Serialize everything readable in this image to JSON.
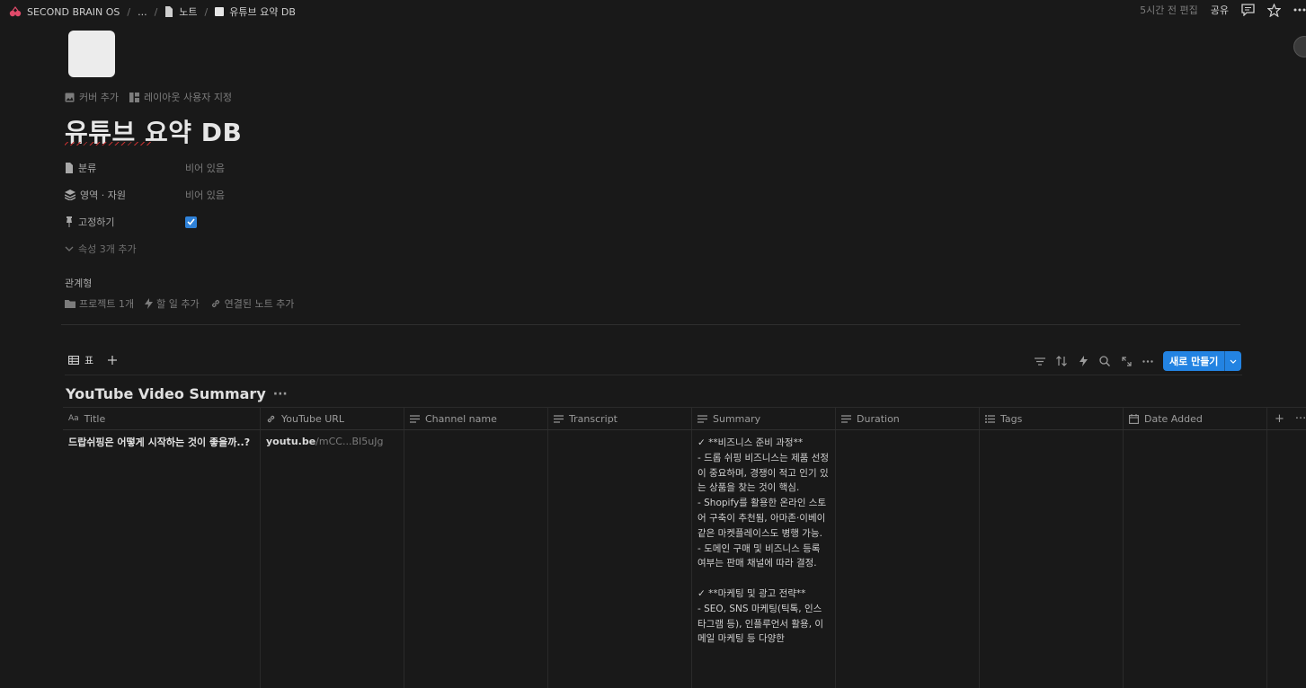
{
  "breadcrumb": {
    "workspace": "SECOND BRAIN OS",
    "ellipsis": "...",
    "parent": "노트",
    "current": "유튜브 요약 DB"
  },
  "topbar": {
    "edited": "5시간 전 편집",
    "share": "공유"
  },
  "page": {
    "add_cover": "커버 추가",
    "customize_layout": "레이아웃 사용자 지정",
    "title": "유튜브 요약 DB"
  },
  "properties": [
    {
      "key": "분류",
      "value": "비어 있음",
      "icon": "document-icon"
    },
    {
      "key": "영역 · 자원",
      "value": "비어 있음",
      "icon": "layers-icon"
    },
    {
      "key": "고정하기",
      "checked": true,
      "icon": "pin-icon"
    }
  ],
  "more_props": "속성 3개 추가",
  "relations": {
    "label": "관계형",
    "project": "프로젝트 1개",
    "todo": "할 일 추가",
    "linked_note": "연결된 노트 추가"
  },
  "view": {
    "tab_label": "표",
    "new_button": "새로 만들기"
  },
  "database": {
    "title": "YouTube Video Summary",
    "columns": [
      "Title",
      "YouTube URL",
      "Channel name",
      "Transcript",
      "Summary",
      "Duration",
      "Tags",
      "Date Added"
    ],
    "rows": [
      {
        "title": "드랍쉬핑은 어떻게 시작하는 것이 좋을까..?",
        "url_domain": "youtu.be",
        "url_path": "/mCC...BI5uJg",
        "channel": "",
        "transcript": "",
        "summary": "✓ **비즈니스 준비 과정**\n  - 드롭 쉬핑 비즈니스는 제품 선정이 중요하며, 경쟁이 적고 인기 있는 상품을 찾는 것이 핵심.\n  - Shopify를 활용한 온라인 스토어 구축이 추천됨, 아마존·이베이 같은 마켓플레이스도 병행 가능.\n  - 도메인 구매 및 비즈니스 등록 여부는 판매 채널에 따라 결정.\n\n✓ **마케팅 및 광고 전략**\n  - SEO, SNS 마케팅(틱톡, 인스타그램 등), 인플루언서 활용, 이메일 마케팅 등 다양한",
        "duration": "",
        "tags": "",
        "date_added": ""
      }
    ]
  }
}
